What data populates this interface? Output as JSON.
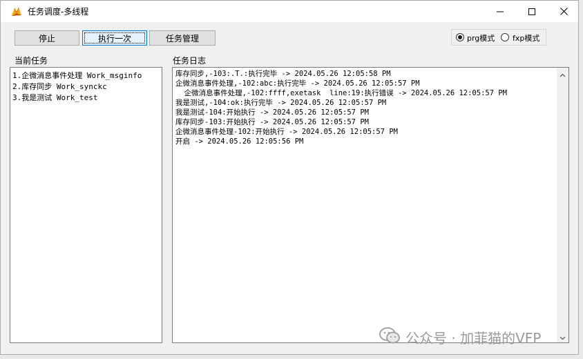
{
  "window": {
    "title": "任务调度-多线程"
  },
  "toolbar": {
    "stop_label": "停止",
    "run_once_label": "执行一次",
    "task_manage_label": "任务管理"
  },
  "mode": {
    "prg_label": "prg模式",
    "fxp_label": "fxp模式",
    "selected": "prg"
  },
  "current_tasks": {
    "label": "当前任务",
    "items": [
      "1.企微消息事件处理 Work_msginfo",
      "2.库存同步 Work_synckc",
      "3.我是测试 Work_test"
    ]
  },
  "task_log": {
    "label": "任务日志",
    "lines": [
      "库存同步,-103:.T.:执行完毕 -> 2024.05.26 12:05:58 PM",
      "企微消息事件处理,-102:abc:执行完毕 -> 2024.05.26 12:05:57 PM",
      "  企微消息事件处理,-102:ffff,exetask  line:19:执行错误 -> 2024.05.26 12:05:57 PM",
      "我是测试,-104:ok:执行完毕 -> 2024.05.26 12:05:57 PM",
      "我是测试-104:开始执行 -> 2024.05.26 12:05:57 PM",
      "库存同步-103:开始执行 -> 2024.05.26 12:05:57 PM",
      "企微消息事件处理-102:开始执行 -> 2024.05.26 12:05:57 PM",
      "开启 -> 2024.05.26 12:05:56 PM"
    ]
  },
  "watermark": {
    "text": "公众号 · 加菲猫的VFP"
  },
  "icons": {
    "app": "vfp-fox-icon",
    "minimize": "minimize-icon",
    "maximize": "maximize-icon",
    "close": "close-icon"
  }
}
